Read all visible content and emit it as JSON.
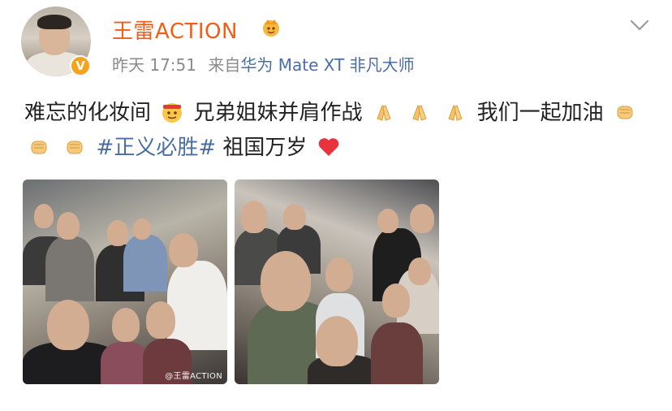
{
  "post": {
    "username": "王雷ACTION",
    "time": "昨天 17:51",
    "source_prefix": "来自",
    "device": "华为 Mate XT 非凡大师",
    "verified_badge": "V",
    "icons": {
      "verified": "verified-badge-icon",
      "crown": "crown-icon",
      "menu": "chevron-down-icon"
    },
    "text": {
      "part1": "难忘的化妆间",
      "part2": "兄弟姐妹并肩作战",
      "part3": "我们一起加油",
      "topic": "#正义必胜#",
      "part4": " 祖国万岁"
    },
    "image_watermark": "@王雷ACTION"
  },
  "colors": {
    "username": "#f25e18",
    "link": "#4a6da8",
    "meta": "#8a8a8a",
    "verified": "#f7a21b"
  }
}
